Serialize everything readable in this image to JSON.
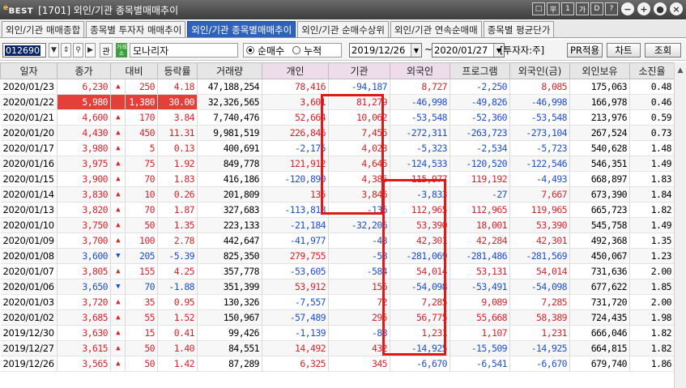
{
  "window": {
    "logo": "BEST",
    "title": "[1701] 외인/기관 종목별매매추이",
    "buttons": [
      "□",
      "平",
      "1",
      "가",
      "D",
      "?"
    ],
    "circle_buttons": [
      "−",
      "+",
      "●",
      "×"
    ]
  },
  "tabs": [
    {
      "label": "외인/기관 매매종합",
      "active": false
    },
    {
      "label": "종목별 투자자 매매추이",
      "active": false
    },
    {
      "label": "외인/기관 종목별매매추이",
      "active": true
    },
    {
      "label": "외인/기관 순매수상위",
      "active": false
    },
    {
      "label": "외인/기관 연속순매매",
      "active": false
    },
    {
      "label": "종목별 평균단가",
      "active": false
    }
  ],
  "toolbar": {
    "stock_code": "012690",
    "gwan_label": "관",
    "market_badge": "거래소",
    "stock_name": "모나리자",
    "radio_net": "순매수",
    "radio_cumulative": "누적",
    "date_from": "2019/12/26",
    "date_to": "2020/01/27",
    "tilde": "~",
    "investor_label": "[투자자:주]",
    "pr_button": "PR적용",
    "chart_button": "차트",
    "query_button": "조회"
  },
  "table": {
    "headers": [
      "일자",
      "종가",
      "대비",
      "",
      "등락률",
      "거래량",
      "개인",
      "기관",
      "외국인",
      "프로그램",
      "외국인(금)",
      "외인보유",
      "소진율"
    ],
    "rows": [
      [
        "2020/01/23",
        "6,230",
        "▲",
        "250",
        "4.18",
        "47,188,254",
        "78,416",
        "-94,187",
        "8,727",
        "-2,250",
        "8,085",
        "175,063",
        "0.48"
      ],
      [
        "2020/01/22",
        "5,980",
        "",
        "1,380",
        "30.00",
        "32,326,565",
        "3,601",
        "81,279",
        "-46,998",
        "-49,826",
        "-46,998",
        "166,978",
        "0.46"
      ],
      [
        "2020/01/21",
        "4,600",
        "▲",
        "170",
        "3.84",
        "7,740,476",
        "52,664",
        "10,062",
        "-53,548",
        "-52,360",
        "-53,548",
        "213,976",
        "0.59"
      ],
      [
        "2020/01/20",
        "4,430",
        "▲",
        "450",
        "11.31",
        "9,981,519",
        "226,846",
        "7,455",
        "-272,311",
        "-263,723",
        "-273,104",
        "267,524",
        "0.73"
      ],
      [
        "2020/01/17",
        "3,980",
        "▲",
        "5",
        "0.13",
        "400,691",
        "-2,175",
        "4,023",
        "-5,323",
        "-2,534",
        "-5,723",
        "540,628",
        "1.48"
      ],
      [
        "2020/01/16",
        "3,975",
        "▲",
        "75",
        "1.92",
        "849,778",
        "121,912",
        "4,645",
        "-124,533",
        "-120,520",
        "-122,546",
        "546,351",
        "1.49"
      ],
      [
        "2020/01/15",
        "3,900",
        "▲",
        "70",
        "1.83",
        "416,186",
        "-120,890",
        "4,385",
        "115,977",
        "119,192",
        "-4,493",
        "668,897",
        "1.83"
      ],
      [
        "2020/01/14",
        "3,830",
        "▲",
        "10",
        "0.26",
        "201,809",
        "135",
        "3,846",
        "-3,833",
        "-27",
        "7,667",
        "673,390",
        "1.84"
      ],
      [
        "2020/01/13",
        "3,820",
        "▲",
        "70",
        "1.87",
        "327,683",
        "-113,818",
        "-136",
        "112,965",
        "112,965",
        "119,965",
        "665,723",
        "1.82"
      ],
      [
        "2020/01/10",
        "3,750",
        "▲",
        "50",
        "1.35",
        "223,133",
        "-21,184",
        "-32,206",
        "53,390",
        "18,001",
        "53,390",
        "545,758",
        "1.49"
      ],
      [
        "2020/01/09",
        "3,700",
        "▲",
        "100",
        "2.78",
        "442,647",
        "-41,977",
        "-48",
        "42,301",
        "42,284",
        "42,301",
        "492,368",
        "1.35"
      ],
      [
        "2020/01/08",
        "3,600",
        "▼",
        "205",
        "-5.39",
        "825,350",
        "279,755",
        "-58",
        "-281,069",
        "-281,486",
        "-281,569",
        "450,067",
        "1.23"
      ],
      [
        "2020/01/07",
        "3,805",
        "▲",
        "155",
        "4.25",
        "357,778",
        "-53,605",
        "-584",
        "54,014",
        "53,131",
        "54,014",
        "731,636",
        "2.00"
      ],
      [
        "2020/01/06",
        "3,650",
        "▼",
        "70",
        "-1.88",
        "351,399",
        "53,912",
        "156",
        "-54,098",
        "-53,491",
        "-54,098",
        "677,622",
        "1.85"
      ],
      [
        "2020/01/03",
        "3,720",
        "▲",
        "35",
        "0.95",
        "130,326",
        "-7,557",
        "72",
        "7,285",
        "9,089",
        "7,285",
        "731,720",
        "2.00"
      ],
      [
        "2020/01/02",
        "3,685",
        "▲",
        "55",
        "1.52",
        "150,967",
        "-57,489",
        "295",
        "56,775",
        "55,668",
        "58,389",
        "724,435",
        "1.98"
      ],
      [
        "2019/12/30",
        "3,630",
        "▲",
        "15",
        "0.41",
        "99,426",
        "-1,139",
        "-88",
        "1,231",
        "1,107",
        "1,231",
        "666,046",
        "1.82"
      ],
      [
        "2019/12/27",
        "3,615",
        "▲",
        "50",
        "1.40",
        "84,551",
        "14,492",
        "432",
        "-14,925",
        "-15,509",
        "-14,925",
        "664,815",
        "1.82"
      ],
      [
        "2019/12/26",
        "3,565",
        "▲",
        "50",
        "1.42",
        "87,289",
        "6,325",
        "345",
        "-6,670",
        "-6,541",
        "-6,670",
        "679,740",
        "1.86"
      ]
    ]
  },
  "colors": {
    "up": "#d8232a",
    "down": "#1e4fcc",
    "limit_up_bg": "#e3403a",
    "annotation_box": "#e01818",
    "active_tab": "#2f62b8"
  }
}
